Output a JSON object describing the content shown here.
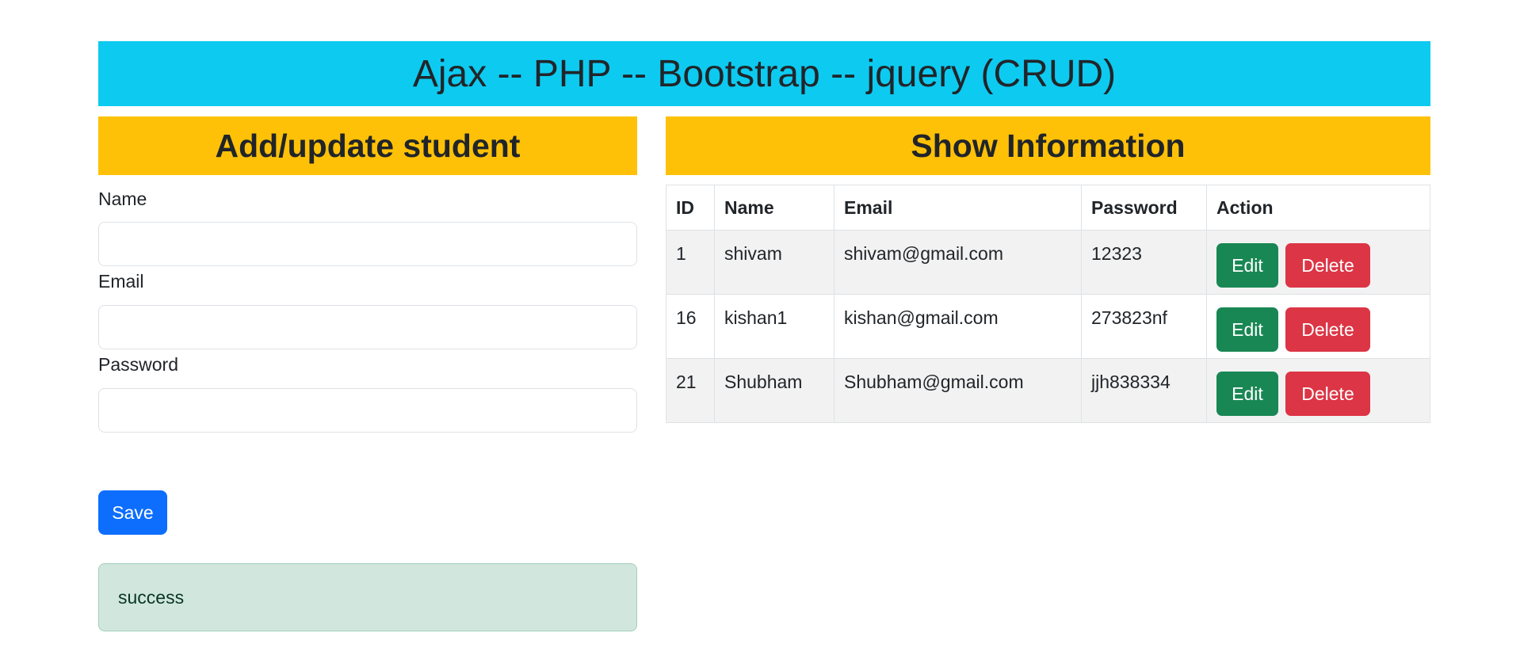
{
  "header": {
    "title": "Ajax -- PHP -- Bootstrap -- jquery (CRUD)"
  },
  "form": {
    "title": "Add/update student",
    "name_label": "Name",
    "name_value": "",
    "email_label": "Email",
    "email_value": "",
    "password_label": "Password",
    "password_value": "",
    "save_label": "Save",
    "alert_text": "success"
  },
  "info": {
    "title": "Show Information",
    "columns": [
      "ID",
      "Name",
      "Email",
      "Password",
      "Action"
    ],
    "rows": [
      {
        "id": "1",
        "name": "shivam",
        "email": "shivam@gmail.com",
        "password": "12323"
      },
      {
        "id": "16",
        "name": "kishan1",
        "email": "kishan@gmail.com",
        "password": "273823nf"
      },
      {
        "id": "21",
        "name": "Shubham",
        "email": "Shubham@gmail.com",
        "password": "jjh838334"
      }
    ],
    "edit_label": "Edit",
    "delete_label": "Delete"
  },
  "colors": {
    "header_bg": "#0dcaf0",
    "panel_title_bg": "#ffc107",
    "save_button": "#0d6efd",
    "edit_button": "#198754",
    "delete_button": "#dc3545",
    "alert_bg": "#d1e7dd"
  }
}
